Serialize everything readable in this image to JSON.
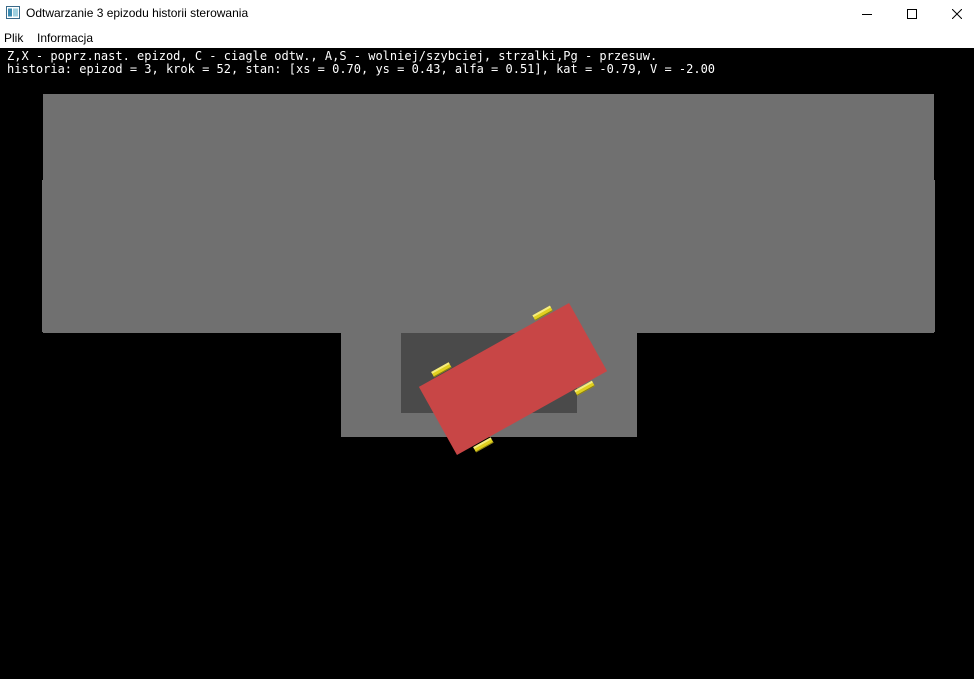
{
  "window": {
    "title": "Odtwarzanie 3 epizodu historii sterowania",
    "icon": "app-window-icon",
    "controls": [
      "minimize-icon",
      "maximize-icon",
      "close-icon"
    ]
  },
  "menu": {
    "items": [
      {
        "label": "Plik"
      },
      {
        "label": "Informacja"
      }
    ]
  },
  "hud": {
    "line1": "Z,X - poprz.nast. epizod, C - ciagle odtw., A,S - wolniej/szybciej, strzalki,Pg - przesuw.",
    "line2": "historia: epizod = 3, krok = 52, stan: [xs = 0.70, ys = 0.43, alfa = 0.51], kat = -0.79, V = -2.00"
  },
  "colors": {
    "background": "#000000",
    "road": "#707070",
    "parking_spot": "#4a4a4a",
    "car_body": "#c84646",
    "wheel": "#e0d020"
  }
}
